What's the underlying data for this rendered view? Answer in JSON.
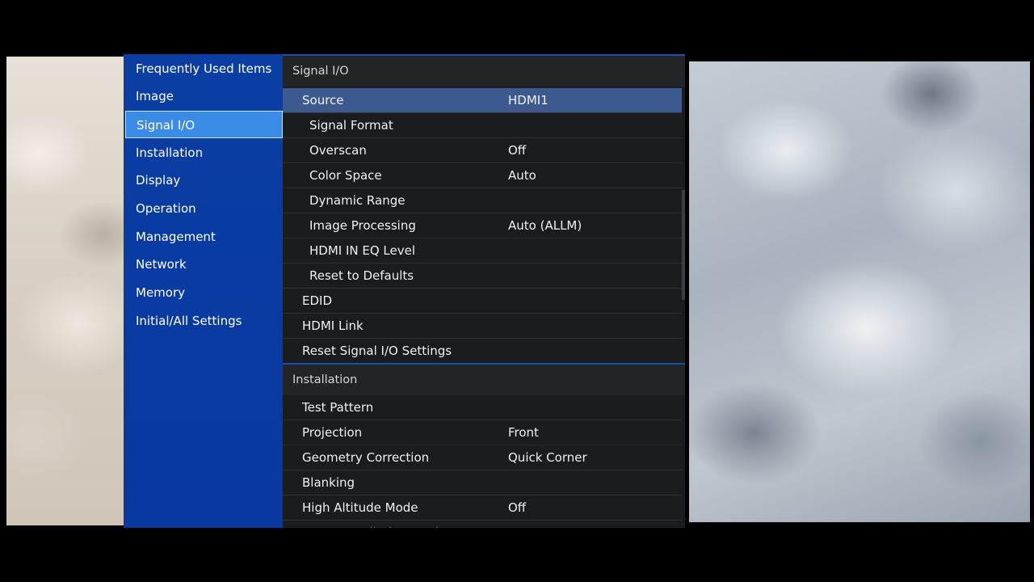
{
  "sidebar": {
    "items": [
      {
        "label": "Frequently Used Items"
      },
      {
        "label": "Image"
      },
      {
        "label": "Signal I/O"
      },
      {
        "label": "Installation"
      },
      {
        "label": "Display"
      },
      {
        "label": "Operation"
      },
      {
        "label": "Management"
      },
      {
        "label": "Network"
      },
      {
        "label": "Memory"
      },
      {
        "label": "Initial/All Settings"
      }
    ],
    "active_index": 2
  },
  "signal_io": {
    "header": "Signal I/O",
    "rows": [
      {
        "label": "Source",
        "value": "HDMI1"
      },
      {
        "label": "Signal Format",
        "value": ""
      },
      {
        "label": "Overscan",
        "value": "Off"
      },
      {
        "label": "Color Space",
        "value": "Auto"
      },
      {
        "label": "Dynamic Range",
        "value": ""
      },
      {
        "label": "Image Processing",
        "value": "Auto (ALLM)"
      },
      {
        "label": "HDMI IN EQ Level",
        "value": ""
      },
      {
        "label": "Reset to Defaults",
        "value": ""
      },
      {
        "label": "EDID",
        "value": ""
      },
      {
        "label": "HDMI Link",
        "value": ""
      },
      {
        "label": "Reset Signal I/O Settings",
        "value": ""
      }
    ]
  },
  "installation": {
    "header": "Installation",
    "rows": [
      {
        "label": "Test Pattern",
        "value": ""
      },
      {
        "label": "Projection",
        "value": "Front"
      },
      {
        "label": "Geometry Correction",
        "value": "Quick Corner"
      },
      {
        "label": "Blanking",
        "value": ""
      },
      {
        "label": "High Altitude Mode",
        "value": "Off"
      },
      {
        "label": "Reset Installation Settings",
        "value": ""
      }
    ]
  },
  "colors": {
    "sidebar_bg": "#0a3ea3",
    "active_item": "#3a8be6",
    "selected_row": "#3c5a8f",
    "content_bg": "#1b1c1e"
  }
}
